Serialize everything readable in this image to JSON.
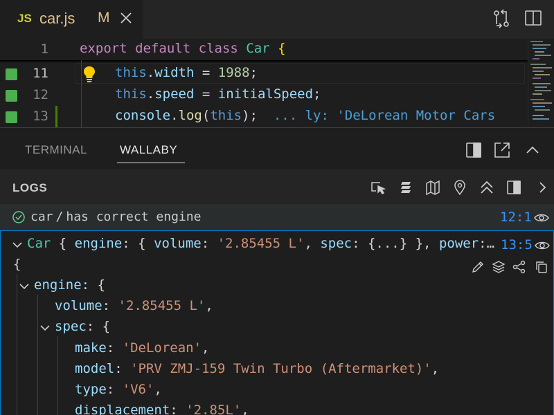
{
  "tab": {
    "badge": "JS",
    "filename": "car.js",
    "modified": "M"
  },
  "editor": {
    "lines": [
      {
        "num": "1",
        "tokens": [
          [
            "kw",
            "export"
          ],
          [
            "pl",
            " "
          ],
          [
            "kw",
            "default"
          ],
          [
            "pl",
            " "
          ],
          [
            "kw",
            "class"
          ],
          [
            "pl",
            " "
          ],
          [
            "cls",
            "Car"
          ],
          [
            "pl",
            " "
          ],
          [
            "br",
            "{"
          ]
        ]
      },
      {
        "num": "11",
        "tokens": [
          [
            "th",
            "this"
          ],
          [
            "pl",
            "."
          ],
          [
            "pr",
            "width"
          ],
          [
            "pl",
            " = "
          ],
          [
            "num",
            "1988"
          ],
          [
            "pl",
            ";"
          ]
        ]
      },
      {
        "num": "12",
        "tokens": [
          [
            "th",
            "this"
          ],
          [
            "pl",
            "."
          ],
          [
            "pr",
            "speed"
          ],
          [
            "pl",
            " = "
          ],
          [
            "pr",
            "initialSpeed"
          ],
          [
            "pl",
            ";"
          ]
        ]
      },
      {
        "num": "13",
        "tokens": [
          [
            "pr",
            "console"
          ],
          [
            "pl",
            "."
          ],
          [
            "fn",
            "log"
          ],
          [
            "pl",
            "("
          ],
          [
            "th",
            "this"
          ],
          [
            "pl",
            ");  "
          ],
          [
            "ghost",
            "... ly: 'DeLorean Motor Cars"
          ]
        ]
      }
    ]
  },
  "panel": {
    "tabs": [
      "TERMINAL",
      "WALLABY"
    ],
    "active_tab": "WALLABY",
    "logs_title": "LOGS",
    "test": {
      "path": "car",
      "separator": "/",
      "name": "has correct engine",
      "position": "12:1"
    },
    "log": {
      "summary_head": "Car",
      "summary_tokens": [
        [
          "pl",
          " { "
        ],
        [
          "pr",
          "engine"
        ],
        [
          "pl",
          ": { "
        ],
        [
          "pr",
          "volume"
        ],
        [
          "pl",
          ": "
        ],
        [
          "str",
          "'2.85455 L'"
        ],
        [
          "pl",
          ", "
        ],
        [
          "pr",
          "spec"
        ],
        [
          "pl",
          ": {...} }, "
        ],
        [
          "pr",
          "power"
        ],
        [
          "pl",
          ":…"
        ]
      ],
      "position": "13:5",
      "open_brace": "{",
      "tree": [
        {
          "indent": 1,
          "chevron": true,
          "tokens": [
            [
              "pr",
              "engine"
            ],
            [
              "pl",
              ": {"
            ]
          ]
        },
        {
          "indent": 2,
          "chevron": false,
          "tokens": [
            [
              "pr",
              "volume"
            ],
            [
              "pl",
              ": "
            ],
            [
              "str",
              "'2.85455 L'"
            ],
            [
              "pl",
              ","
            ]
          ]
        },
        {
          "indent": 2,
          "chevron": true,
          "tokens": [
            [
              "pr",
              "spec"
            ],
            [
              "pl",
              ": {"
            ]
          ]
        },
        {
          "indent": 3,
          "chevron": false,
          "tokens": [
            [
              "pr",
              "make"
            ],
            [
              "pl",
              ": "
            ],
            [
              "str",
              "'DeLorean'"
            ],
            [
              "pl",
              ","
            ]
          ]
        },
        {
          "indent": 3,
          "chevron": false,
          "tokens": [
            [
              "pr",
              "model"
            ],
            [
              "pl",
              ": "
            ],
            [
              "str",
              "'PRV ZMJ-159 Twin Turbo (Aftermarket)'"
            ],
            [
              "pl",
              ","
            ]
          ]
        },
        {
          "indent": 3,
          "chevron": false,
          "tokens": [
            [
              "pr",
              "type"
            ],
            [
              "pl",
              ": "
            ],
            [
              "str",
              "'V6'"
            ],
            [
              "pl",
              ","
            ]
          ]
        },
        {
          "indent": 3,
          "chevron": false,
          "tokens": [
            [
              "pr",
              "displacement"
            ],
            [
              "pl",
              ": "
            ],
            [
              "str",
              "'2.85L'"
            ],
            [
              "pl",
              ","
            ]
          ]
        }
      ]
    }
  },
  "colors": {
    "accent": "#3794ff",
    "coverage": "#4caf50",
    "focus_border": "#007fd4"
  },
  "icons": [
    "close-icon",
    "git-compare-icon",
    "split-editor-icon",
    "lightbulb-icon",
    "layout-panel-icon",
    "maximize-icon",
    "chevron-up-icon",
    "inspect-icon",
    "stack-icon",
    "map-icon",
    "location-pin-icon",
    "collapse-all-icon",
    "toggle-sidebar-icon",
    "chevron-right-icon",
    "check-circle-icon",
    "eye-icon",
    "chevron-down-icon",
    "edit-icon",
    "layers-icon",
    "share-icon",
    "copy-icon"
  ]
}
